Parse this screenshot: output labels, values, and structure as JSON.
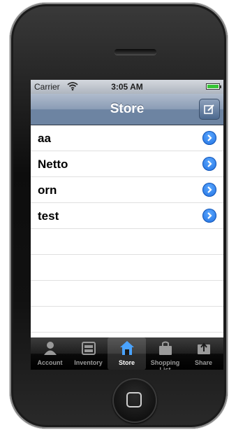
{
  "status": {
    "carrier": "Carrier",
    "time": "3:05 AM"
  },
  "nav": {
    "title": "Store"
  },
  "rows": [
    {
      "label": "aa"
    },
    {
      "label": "Netto"
    },
    {
      "label": "orn"
    },
    {
      "label": "test"
    }
  ],
  "tabs": [
    {
      "label": "Account",
      "icon": "person-icon"
    },
    {
      "label": "Inventory",
      "icon": "inventory-icon"
    },
    {
      "label": "Store",
      "icon": "store-icon",
      "selected": true
    },
    {
      "label": "Shopping List",
      "icon": "shopping-bag-icon"
    },
    {
      "label": "Share",
      "icon": "share-icon"
    }
  ],
  "colors": {
    "accent": "#1f6fe0",
    "nav": "#6d84a2"
  }
}
